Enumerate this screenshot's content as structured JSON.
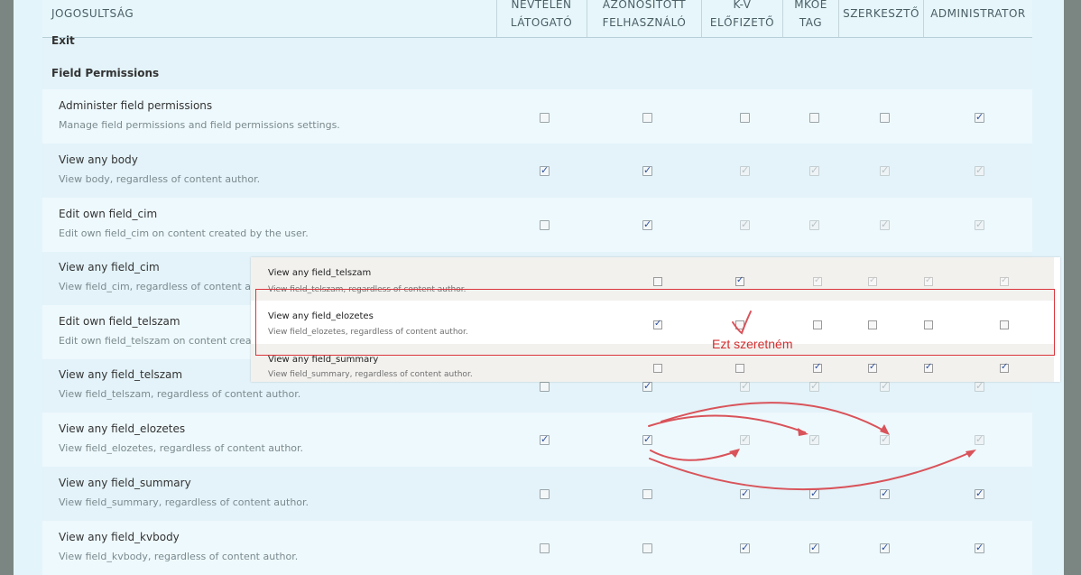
{
  "header": {
    "permission": "JOGOSULTSÁG",
    "roles": [
      "NÉVTELEN LÁTOGATÓ",
      "AZONOSÍTOTT FELHASZNÁLÓ",
      "K-V ELŐFIZETŐ",
      "MKOE TAG",
      "SZERKESZTŐ",
      "ADMINISTRATOR"
    ]
  },
  "partial_row": "Exit",
  "section_title": "Field Permissions",
  "rows": [
    {
      "label": "Administer field permissions",
      "desc": "Manage field permissions and field permissions settings.",
      "checks": [
        "off",
        "off",
        "off",
        "off",
        "off",
        "on"
      ]
    },
    {
      "label": "View any body",
      "desc": "View body, regardless of content author.",
      "checks": [
        "on",
        "on",
        "dis",
        "dis",
        "dis",
        "dis"
      ]
    },
    {
      "label": "Edit own field_cim",
      "desc": "Edit own field_cim on content created by the user.",
      "checks": [
        "off",
        "on",
        "dis",
        "dis",
        "dis",
        "dis"
      ]
    },
    {
      "label": "View any field_cim",
      "desc": "View field_cim, regardless of content author.",
      "checks": []
    },
    {
      "label": "Edit own field_telszam",
      "desc": "Edit own field_telszam on content created by the user.",
      "checks": []
    },
    {
      "label": "View any field_telszam",
      "desc": "View field_telszam, regardless of content author.",
      "checks": [
        "off",
        "on",
        "dis",
        "dis",
        "dis",
        "dis"
      ]
    },
    {
      "label": "View any field_elozetes",
      "desc": "View field_elozetes, regardless of content author.",
      "checks": [
        "on",
        "on",
        "dis",
        "dis",
        "dis",
        "dis"
      ]
    },
    {
      "label": "View any field_summary",
      "desc": "View field_summary, regardless of content author.",
      "checks": [
        "off",
        "off",
        "on",
        "on",
        "on",
        "on"
      ]
    },
    {
      "label": "View any field_kvbody",
      "desc": "View field_kvbody, regardless of content author.",
      "checks": [
        "off",
        "off",
        "on",
        "on",
        "on",
        "on"
      ]
    }
  ],
  "inset": {
    "rows": [
      {
        "label": "View any field_telszam",
        "desc": "View field_telszam, regardless of content author.",
        "checks": [
          "off",
          "on",
          "dis",
          "dis",
          "dis",
          "dis"
        ]
      },
      {
        "label": "View any field_elozetes",
        "desc": "View field_elozetes, regardless of content author.",
        "checks": [
          "on",
          "off",
          "off",
          "off",
          "off",
          "off"
        ]
      },
      {
        "label": "View any field_summary",
        "desc": "View field_summary, regardless of content author.",
        "checks": [
          "off",
          "off",
          "on",
          "on",
          "on",
          "on"
        ]
      }
    ],
    "annotation": "Ezt szeretném",
    "annotation_color": "#d32e30"
  }
}
